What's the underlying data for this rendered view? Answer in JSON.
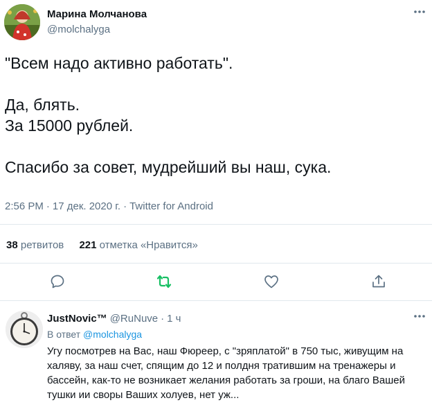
{
  "tweet": {
    "author_name": "Марина Молчанова",
    "author_handle": "@molchalyga",
    "text": "\"Всем надо активно работать\".\n\nДа, блять.\nЗа 15000 рублей.\n\nСпасибо за совет, мудрейший вы наш, сука.",
    "time": "2:56 PM",
    "date": "17 дек. 2020 г.",
    "source": "Twitter for Android",
    "retweets_count": "38",
    "retweets_label": "ретвитов",
    "likes_count": "221",
    "likes_label": "отметка «Нравится»"
  },
  "colors": {
    "text": "#0f1419",
    "secondary": "#5b7083",
    "link": "#1b95e0",
    "retweet_active": "#17bf63",
    "divider": "#e1e8ed"
  },
  "actions": [
    "reply-icon",
    "retweet-icon",
    "like-icon",
    "share-icon"
  ],
  "reply": {
    "author_name": "JustNovic™",
    "author_handle": "@RuNuve",
    "time_ago": "1 ч",
    "in_reply_prefix": "В ответ",
    "in_reply_handle": "@molchalyga",
    "text": "Угу посмотрев на Вас, наш Фюреер, с \"зряплатой\" в 750 тыс, живущим на халяву, за наш счет, спящим до 12 и полдня тратившим на тренажеры и бассейн, как-то не возникает желания работать за гроши, на благо Вашей тушки ии своры Ваших холуев, нет уж..."
  }
}
